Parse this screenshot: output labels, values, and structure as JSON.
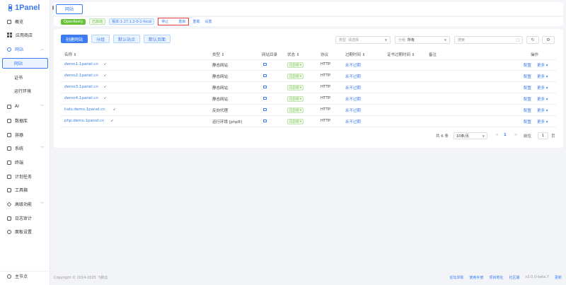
{
  "app": {
    "name": "1Panel"
  },
  "sidebar": {
    "items": [
      {
        "label": "概览",
        "icon": "home-icon"
      },
      {
        "label": "应用商店",
        "icon": "grid-icon"
      },
      {
        "label": "网站",
        "icon": "globe-icon"
      },
      {
        "label": "AI",
        "icon": "ai-icon"
      },
      {
        "label": "数据库",
        "icon": "database-icon"
      },
      {
        "label": "容器",
        "icon": "container-icon"
      },
      {
        "label": "系统",
        "icon": "system-icon"
      },
      {
        "label": "终端",
        "icon": "terminal-icon"
      },
      {
        "label": "计划任务",
        "icon": "calendar-icon"
      },
      {
        "label": "工具箱",
        "icon": "toolbox-icon"
      },
      {
        "label": "高级功能",
        "icon": "diamond-icon"
      },
      {
        "label": "日志审计",
        "icon": "log-icon"
      },
      {
        "label": "面板设置",
        "icon": "settings-icon"
      }
    ],
    "subitems": [
      "网站",
      "证书",
      "运行环境"
    ],
    "footer": "主节点"
  },
  "topbar": {
    "tab": "网站"
  },
  "statusbar": {
    "app_name": "OpenResty",
    "state": "已启动",
    "version": "版本:1.27.1.2-0-1-focal",
    "stop": "停止",
    "restart": "重启",
    "reload": "重载",
    "settings": "设置"
  },
  "toolbar": {
    "create": "创建网站",
    "group": "分组",
    "default_site": "默认站点",
    "default_page": "默认页面"
  },
  "filters": {
    "type_label": "类型",
    "type_placeholder": "请选择",
    "group_label": "分组",
    "group_value": "所有",
    "search_placeholder": "搜索"
  },
  "table": {
    "headers": [
      "名称",
      "类型",
      "网站目录",
      "状态",
      "协议",
      "过期时间",
      "证书过期时间",
      "备注",
      "操作"
    ],
    "rows": [
      {
        "name": "demo1.1panel.cn",
        "type": "静态网站",
        "status": "已启动",
        "protocol": "HTTP",
        "expire": "永不过期",
        "config": "配置",
        "more": "更多"
      },
      {
        "name": "demo2.1panel.cn",
        "type": "静态网站",
        "status": "已启动",
        "protocol": "HTTP",
        "expire": "永不过期",
        "config": "配置",
        "more": "更多"
      },
      {
        "name": "demo3.1panel.cn",
        "type": "静态网站",
        "status": "已启动",
        "protocol": "HTTP",
        "expire": "永不过期",
        "config": "配置",
        "more": "更多"
      },
      {
        "name": "demo4.1panel.cn",
        "type": "静态网站",
        "status": "已启动",
        "protocol": "HTTP",
        "expire": "永不过期",
        "config": "配置",
        "more": "更多"
      },
      {
        "name": "halo.demo.1panel.cn",
        "type": "反向代理",
        "status": "已启动",
        "protocol": "HTTP",
        "expire": "永不过期",
        "config": "配置",
        "more": "更多"
      },
      {
        "name": "php.demo.1panel.cn",
        "type": "运行环境 [php8]",
        "status": "已启动",
        "protocol": "HTTP",
        "expire": "永不过期",
        "config": "配置",
        "more": "更多"
      }
    ]
  },
  "pagination": {
    "total": "共 6 条",
    "page_size": "10条/页",
    "prev": "<",
    "current": "1",
    "next": ">",
    "goto_label": "前往",
    "goto_value": "1",
    "page_suffix": "页"
  },
  "footer": {
    "copyright": "Copyright © 2014-2025 飞致云",
    "links": [
      "论坛求助",
      "使用手册",
      "项目地址",
      "社区版"
    ],
    "version": "v2.0.0-beta.7",
    "update": "更新"
  }
}
